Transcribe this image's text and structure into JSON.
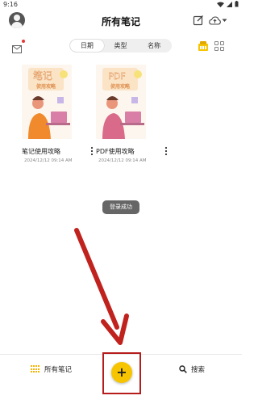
{
  "status_bar": {
    "time": "9:16"
  },
  "header": {
    "title": "所有笔记"
  },
  "toolbar": {
    "sort_tabs": [
      {
        "label": "日期",
        "active": true
      },
      {
        "label": "类型",
        "active": false
      },
      {
        "label": "名称",
        "active": false
      }
    ]
  },
  "notes": [
    {
      "title": "笔记使用攻略",
      "date": "2024/12/12 09:14 AM",
      "cover_text": "笔记",
      "cover_sub": "使用攻略"
    },
    {
      "title": "PDF使用攻略",
      "date": "2024/12/12 09:14 AM",
      "cover_text": "PDF",
      "cover_sub": "使用攻略"
    }
  ],
  "toast": {
    "text": "登录成功"
  },
  "bottom_nav": {
    "notes_label": "所有笔记",
    "search_label": "搜索"
  },
  "fab": {
    "label": "+"
  },
  "colors": {
    "accent": "#f6c400",
    "highlight": "#b71c1c",
    "toast_bg": "#666666"
  }
}
